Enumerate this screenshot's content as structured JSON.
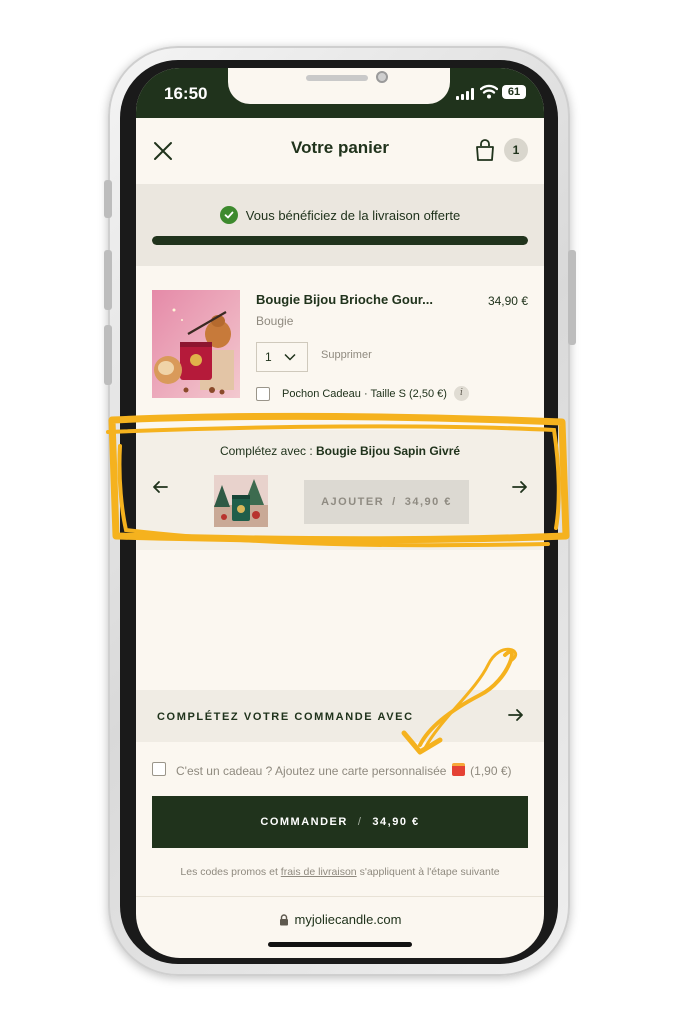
{
  "status_bar": {
    "time": "16:50",
    "battery": "61"
  },
  "header": {
    "title": "Votre panier",
    "cart_count": "1"
  },
  "shipping": {
    "message": "Vous bénéficiez de la livraison offerte",
    "progress": 1.0
  },
  "cart_item": {
    "name": "Bougie Bijou Brioche Gour...",
    "category": "Bougie",
    "price": "34,90 €",
    "quantity": "1",
    "remove_label": "Supprimer",
    "gift_option_label": "Pochon Cadeau · Taille S (2,50 €)",
    "info_icon": "i"
  },
  "upsell": {
    "prefix": "Complétez avec :",
    "product_name": "Bougie Bijou Sapin Givré",
    "add_label": "AJOUTER",
    "separator": "/",
    "price": "34,90 €"
  },
  "complete_order": {
    "label": "COMPLÉTEZ VOTRE COMMANDE AVEC"
  },
  "gift_card": {
    "label_before": "C'est un cadeau ? Ajoutez une carte personnalisée",
    "label_after": "(1,90 €)"
  },
  "checkout": {
    "label": "COMMANDER",
    "separator": "/",
    "total": "34,90 €"
  },
  "footer_note": {
    "part1": "Les codes promos et",
    "link": "frais de livraison",
    "part2": "s'appliquent à l'étape suivante"
  },
  "browser": {
    "url": "myjoliecandle.com"
  },
  "colors": {
    "brand_green": "#20331c",
    "highlight_yellow": "#f5b21e",
    "success_green": "#3d8a2e"
  }
}
